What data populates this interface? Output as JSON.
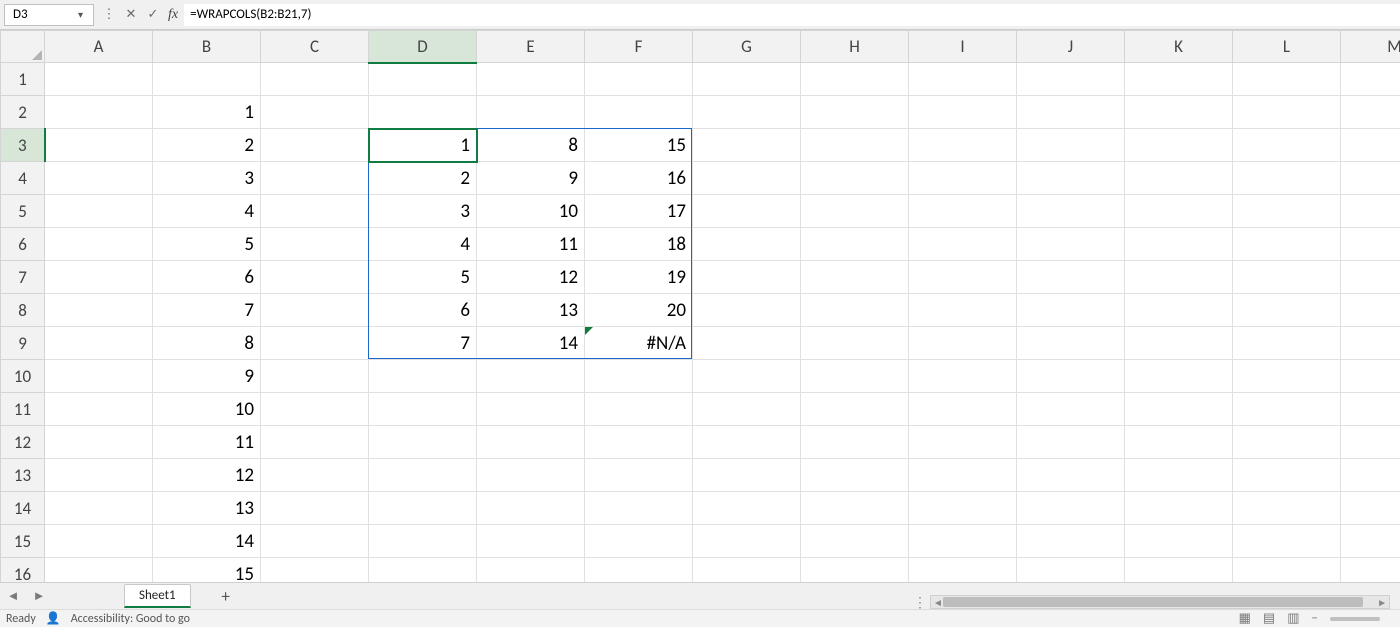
{
  "formula_bar": {
    "name_box": "D3",
    "formula": "=WRAPCOLS(B2:B21,7)"
  },
  "columns": [
    "A",
    "B",
    "C",
    "D",
    "E",
    "F",
    "G",
    "H",
    "I",
    "J",
    "K",
    "L",
    "M"
  ],
  "selected_col_index": 3,
  "row_count": 16,
  "selected_row_index": 2,
  "cells": {
    "b": [
      "1",
      "2",
      "3",
      "4",
      "5",
      "6",
      "7",
      "8",
      "9",
      "10",
      "11",
      "12",
      "13",
      "14",
      "15"
    ],
    "d_spill": [
      "1",
      "2",
      "3",
      "4",
      "5",
      "6",
      "7"
    ],
    "e_spill": [
      "8",
      "9",
      "10",
      "11",
      "12",
      "13",
      "14"
    ],
    "f_spill": [
      "15",
      "16",
      "17",
      "18",
      "19",
      "20",
      "#N/A"
    ]
  },
  "active_cell": {
    "row": 2,
    "col": 3
  },
  "spill_box": {
    "top_row": 2,
    "left_col": 3,
    "rows": 7,
    "cols": 3
  },
  "sheet": {
    "tab_name": "Sheet1"
  },
  "status": {
    "ready": "Ready",
    "accessibility": "Accessibility: Good to go"
  },
  "view_toggle_minus": "−"
}
